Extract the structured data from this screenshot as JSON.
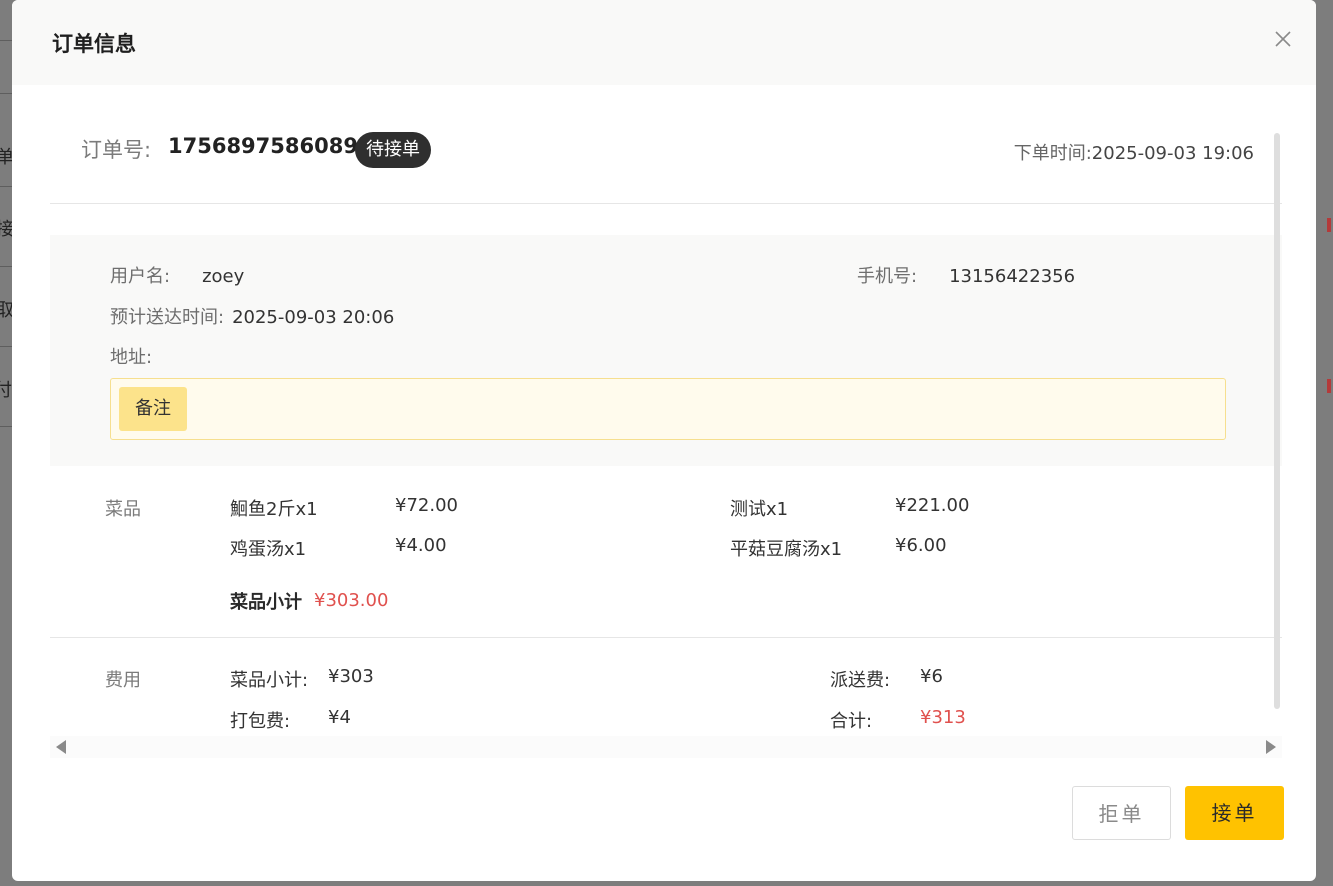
{
  "backdrop": {
    "fragments": [
      "单",
      "接",
      "取",
      "付"
    ]
  },
  "dialog": {
    "title": "订单信息",
    "close_icon": "close-icon"
  },
  "order": {
    "number_label": "订单号:",
    "number": "1756897586089",
    "status": "待接单",
    "time_label": "下单时间:",
    "time": "2025-09-03 19:06"
  },
  "customer": {
    "username_label": "用户名:",
    "username": "zoey",
    "phone_label": "手机号:",
    "phone": "13156422356",
    "eta_label": "预计送达时间:",
    "eta": "2025-09-03 20:06",
    "address_label": "地址:",
    "address": "",
    "remark_label": "备注"
  },
  "dishes": {
    "section_label": "菜品",
    "items": [
      {
        "name": "鮰鱼2斤x1",
        "price": "¥72.00"
      },
      {
        "name": "测试x1",
        "price": "¥221.00"
      },
      {
        "name": "鸡蛋汤x1",
        "price": "¥4.00"
      },
      {
        "name": "平菇豆腐汤x1",
        "price": "¥6.00"
      }
    ],
    "subtotal_label": "菜品小计",
    "subtotal": "¥303.00"
  },
  "fees": {
    "section_label": "费用",
    "dish_subtotal_label": "菜品小计:",
    "dish_subtotal": "¥303",
    "delivery_label": "派送费:",
    "delivery": "¥6",
    "packing_label": "打包费:",
    "packing": "¥4",
    "total_label": "合计:",
    "total": "¥313"
  },
  "actions": {
    "reject": "拒单",
    "accept": "接单"
  },
  "colors": {
    "accent": "#ffc200",
    "price_red": "#e0514e",
    "status_badge": "#2f2f2f",
    "remark_bg": "#fffbed"
  }
}
